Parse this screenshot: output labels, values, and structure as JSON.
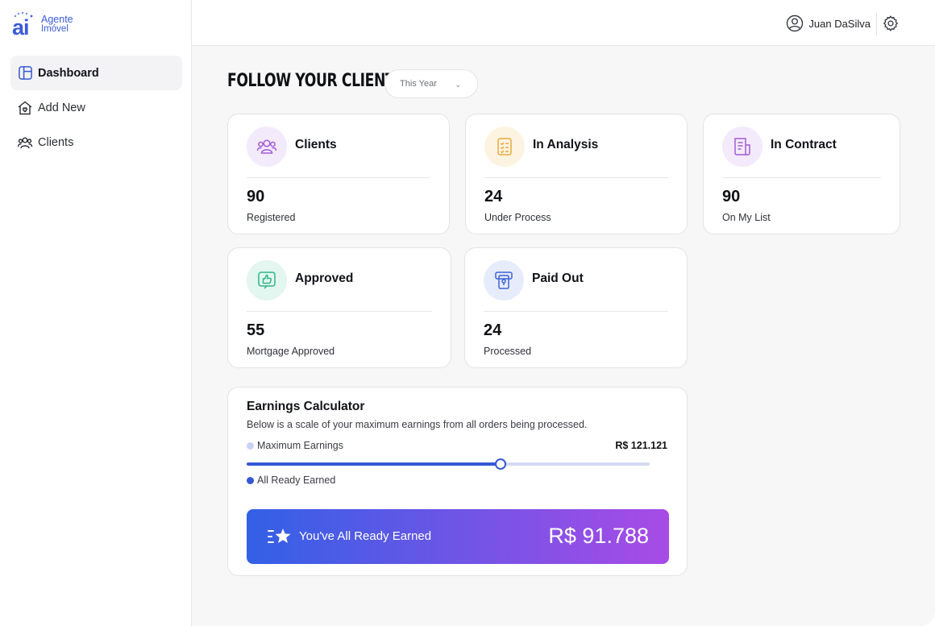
{
  "logo": {
    "mark": "ai",
    "line1": "Agente",
    "line2": "Imóvel"
  },
  "nav": [
    {
      "label": "Dashboard",
      "icon": "layout-icon",
      "active": true
    },
    {
      "label": "Add New",
      "icon": "house-heart-icon",
      "active": false
    },
    {
      "label": "Clients",
      "icon": "users-icon",
      "active": false
    }
  ],
  "user": {
    "name": "Juan DaSilva"
  },
  "header": {
    "title": "FOLLOW YOUR CLIENTS",
    "period": "This Year"
  },
  "cards": [
    {
      "title": "Clients",
      "value": "90",
      "sub": "Registered",
      "icon": "users-icon",
      "color": "#a35bd8",
      "bg": "#f3eafb"
    },
    {
      "title": "In Analysis",
      "value": "24",
      "sub": "Under Process",
      "icon": "checklist-icon",
      "color": "#e8a93b",
      "bg": "#fdf3e1"
    },
    {
      "title": "In Contract",
      "value": "90",
      "sub": "On My List",
      "icon": "document-icon",
      "color": "#a35bd8",
      "bg": "#f3eafb"
    },
    {
      "title": "Approved",
      "value": "55",
      "sub": "Mortgage Approved",
      "icon": "thumbs-up-icon",
      "color": "#2fb58a",
      "bg": "#e3f6ef"
    },
    {
      "title": "Paid Out",
      "value": "24",
      "sub": "Processed",
      "icon": "receipt-icon",
      "color": "#3e63d8",
      "bg": "#e7ecfb"
    }
  ],
  "earnings": {
    "title": "Earnings Calculator",
    "description": "Below is a scale of your maximum earnings from all orders being processed.",
    "max_label": "Maximum Earnings",
    "max_value": "R$ 121.121",
    "earned_label": "All Ready Earned",
    "progress": 0.63,
    "banner_label": "You've All Ready Earned",
    "banner_value": "R$ 91.788",
    "colors": {
      "max_dot": "#c9d3f5",
      "earned_dot": "#3558d6"
    }
  }
}
